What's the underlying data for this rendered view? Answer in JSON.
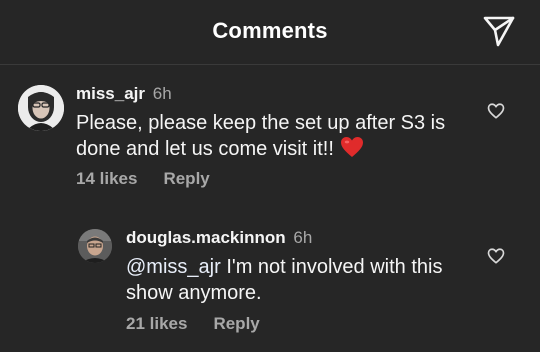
{
  "header": {
    "title": "Comments",
    "share_icon": "paper-plane-icon"
  },
  "comments": [
    {
      "username": "miss_ajr",
      "time": "6h",
      "text": "Please, please keep the set up after S3 is done and let us come visit it!!",
      "emoji": "heart-emoji",
      "likes": "14 likes",
      "reply_label": "Reply",
      "like_icon": "heart-outline-icon"
    },
    {
      "username": "douglas.mackinnon",
      "time": "6h",
      "mention": "@miss_ajr",
      "text": " I'm not involved with this show anymore.",
      "likes": "21 likes",
      "reply_label": "Reply",
      "like_icon": "heart-outline-icon"
    }
  ],
  "colors": {
    "background": "#262626",
    "text_primary": "#f5f5f5",
    "text_secondary": "#a8a8a8",
    "heart_red": "#e02b2b",
    "divider": "#3a3a3a"
  }
}
